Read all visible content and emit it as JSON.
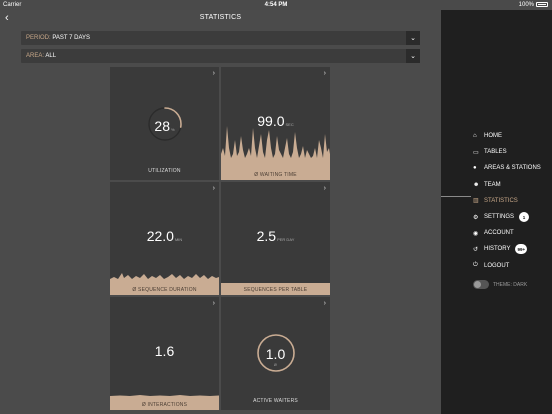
{
  "status_bar": {
    "carrier": "Carrier",
    "time": "4:54 PM",
    "battery": "100%"
  },
  "nav": {
    "back": "‹",
    "title": "STATISTICS"
  },
  "filters": [
    {
      "label": "PERIOD:",
      "value": "PAST 7 DAYS"
    },
    {
      "label": "AREA:",
      "value": "ALL"
    }
  ],
  "tiles": {
    "utilization": {
      "value": "28",
      "unit": "%",
      "caption": "UTILIZATION",
      "progress": 0.28
    },
    "waiting_time": {
      "value": "99.0",
      "unit": "SEC",
      "caption": "Ø WAITING TIME"
    },
    "sequence_duration": {
      "value": "22.0",
      "unit": "MIN",
      "caption": "Ø SEQUENCE DURATION"
    },
    "sequences_per_table": {
      "value": "2.5",
      "unit": "PER DAY",
      "caption": "SEQUENCES PER TABLE"
    },
    "interactions": {
      "value": "1.6",
      "unit": "",
      "caption": "Ø INTERACTIONS"
    },
    "active_waiters": {
      "value": "1.0",
      "unit": "Ø",
      "caption": "ACTIVE WAITERS"
    }
  },
  "menu": [
    {
      "icon": "⌂",
      "label": "HOME"
    },
    {
      "icon": "▭",
      "label": "TABLES"
    },
    {
      "icon": "●",
      "label": "AREAS & STATIONS"
    },
    {
      "icon": "☻",
      "label": "TEAM"
    },
    {
      "icon": "▥",
      "label": "STATISTICS",
      "active": true
    },
    {
      "icon": "⚙",
      "label": "SETTINGS",
      "badge": "1"
    },
    {
      "icon": "◉",
      "label": "ACCOUNT"
    },
    {
      "icon": "↺",
      "label": "HISTORY",
      "badge": "99+"
    },
    {
      "icon": "⏻",
      "label": "LOGOUT"
    }
  ],
  "theme_toggle": {
    "label": "THEME: DARK"
  },
  "colors": {
    "accent": "#c8a889",
    "tile": "#3a3a3a",
    "panel": "#4b4b4b",
    "sidebar": "#1f1f1f"
  }
}
